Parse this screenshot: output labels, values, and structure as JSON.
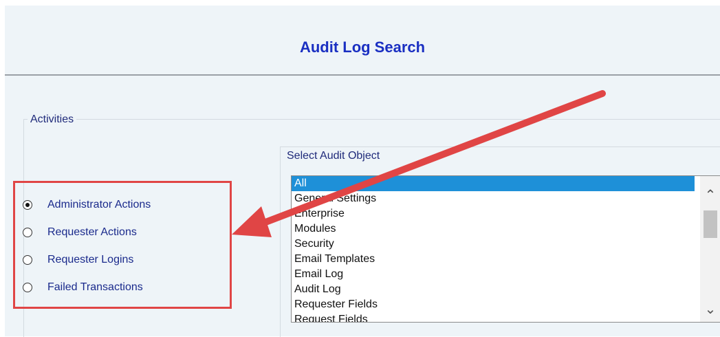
{
  "page": {
    "title": "Audit Log Search"
  },
  "activities": {
    "legend": "Activities",
    "radios": [
      {
        "label": "Administrator Actions",
        "checked": true
      },
      {
        "label": "Requester Actions",
        "checked": false
      },
      {
        "label": "Requester Logins",
        "checked": false
      },
      {
        "label": "Failed Transactions",
        "checked": false
      }
    ]
  },
  "audit_object": {
    "label": "Select Audit Object",
    "items": [
      "All",
      "General Settings",
      "Enterprise",
      "Modules",
      "Security",
      "Email Templates",
      "Email Log",
      "Audit Log",
      "Requester Fields",
      "Request Fields"
    ],
    "selected": "All"
  },
  "colors": {
    "annotation": "#e04545",
    "selection": "#1e90d8",
    "title": "#1a2fc2"
  }
}
